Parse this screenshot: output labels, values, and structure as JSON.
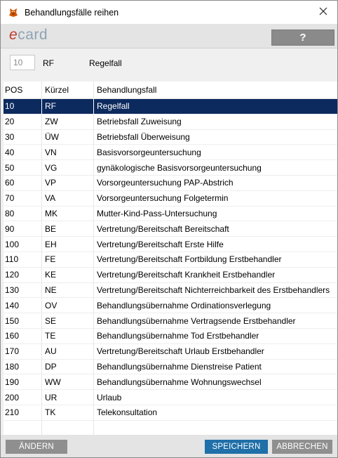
{
  "window": {
    "title": "Behandlungsfälle reihen"
  },
  "brand": {
    "logo_prefix": "e",
    "logo_rest": "card",
    "help_label": "?"
  },
  "current": {
    "pos": "10",
    "code": "RF",
    "name": "Regelfall"
  },
  "table": {
    "columns": [
      "POS",
      "Kürzel",
      "Behandlungsfall"
    ],
    "selected_index": 0,
    "rows": [
      {
        "pos": "10",
        "code": "RF",
        "name": "Regelfall"
      },
      {
        "pos": "20",
        "code": "ZW",
        "name": "Betriebsfall Zuweisung"
      },
      {
        "pos": "30",
        "code": "ÜW",
        "name": "Betriebsfall Überweisung"
      },
      {
        "pos": "40",
        "code": "VN",
        "name": "Basisvorsorgeuntersuchung"
      },
      {
        "pos": "50",
        "code": "VG",
        "name": "gynäkologische Basisvorsorgeuntersuchung"
      },
      {
        "pos": "60",
        "code": "VP",
        "name": "Vorsorgeuntersuchung PAP-Abstrich"
      },
      {
        "pos": "70",
        "code": "VA",
        "name": "Vorsorgeuntersuchung Folgetermin"
      },
      {
        "pos": "80",
        "code": "MK",
        "name": "Mutter-Kind-Pass-Untersuchung"
      },
      {
        "pos": "90",
        "code": "BE",
        "name": "Vertretung/Bereitschaft Bereitschaft"
      },
      {
        "pos": "100",
        "code": "EH",
        "name": "Vertretung/Bereitschaft Erste Hilfe"
      },
      {
        "pos": "110",
        "code": "FE",
        "name": "Vertretung/Bereitschaft Fortbildung Erstbehandler"
      },
      {
        "pos": "120",
        "code": "KE",
        "name": "Vertretung/Bereitschaft Krankheit Erstbehandler"
      },
      {
        "pos": "130",
        "code": "NE",
        "name": "Vertretung/Bereitschaft Nichterreichbarkeit des Erstbehandlers"
      },
      {
        "pos": "140",
        "code": "OV",
        "name": "Behandlungsübernahme Ordinationsverlegung"
      },
      {
        "pos": "150",
        "code": "SE",
        "name": "Behandlungsübernahme Vertragsende Erstbehandler"
      },
      {
        "pos": "160",
        "code": "TE",
        "name": "Behandlungsübernahme Tod Erstbehandler"
      },
      {
        "pos": "170",
        "code": "AU",
        "name": "Vertretung/Bereitschaft Urlaub Erstbehandler"
      },
      {
        "pos": "180",
        "code": "DP",
        "name": "Behandlungsübernahme Dienstreise Patient"
      },
      {
        "pos": "190",
        "code": "WW",
        "name": "Behandlungsübernahme Wohnungswechsel"
      },
      {
        "pos": "200",
        "code": "UR",
        "name": "Urlaub"
      },
      {
        "pos": "210",
        "code": "TK",
        "name": "Telekonsultation"
      }
    ]
  },
  "footer": {
    "aendern_label": "ÄNDERN",
    "speichern_label": "SPEICHERN",
    "abbrechen_label": "ABBRECHEN"
  },
  "colors": {
    "selected_row": "#0c2a5e",
    "primary_button": "#1f6fa8",
    "secondary_button": "#8f8f8f"
  },
  "icons": {
    "app": "app-logo-icon",
    "close": "close-icon"
  }
}
